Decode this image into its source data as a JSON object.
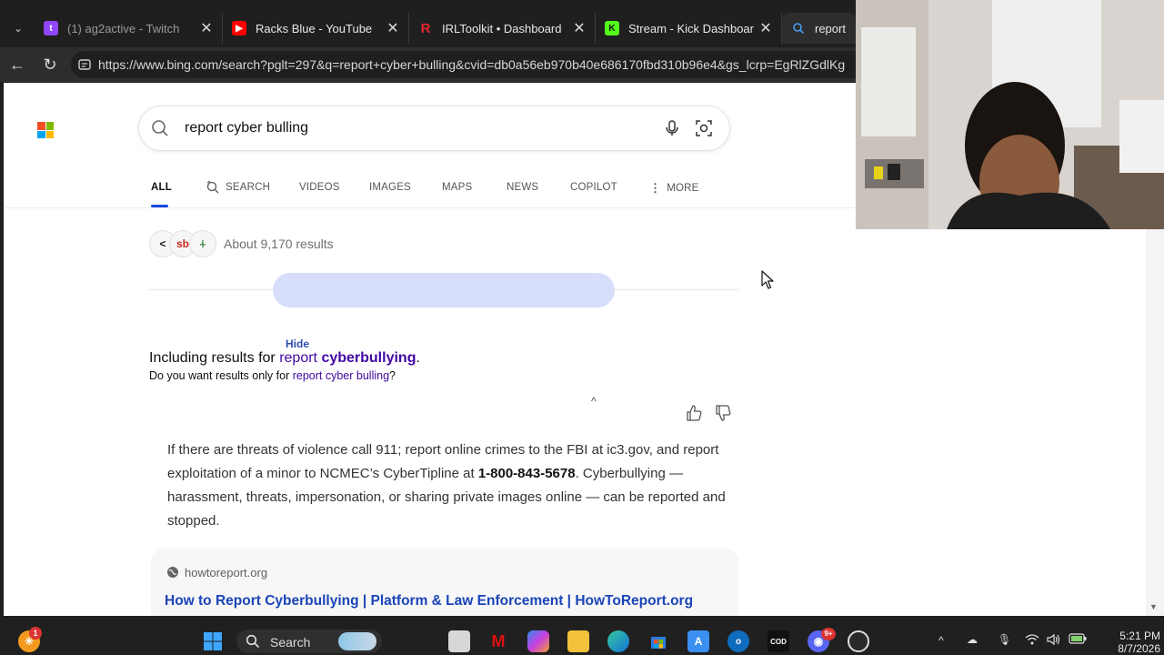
{
  "browser": {
    "tabs": [
      {
        "title": "(1) ag2active - Twitch",
        "icon": "twitch-icon",
        "color": "#9146ff"
      },
      {
        "title": "Racks Blue - YouTube",
        "icon": "youtube-icon",
        "color": "#ff0000"
      },
      {
        "title": "IRLToolkit • Dashboard",
        "icon": "irltoolkit-icon",
        "color": "#e3262f"
      },
      {
        "title": "Stream - Kick Dashboard",
        "icon": "kick-icon",
        "color": "#53fc18"
      },
      {
        "title": "report cybe",
        "icon": "search-icon",
        "color": "#4a9cf0"
      }
    ],
    "close_glyph": "✕",
    "url": "https://www.bing.com/search?pglt=297&q=report+cyber+bulling&cvid=db0a56eb970b40e686170fbd310b96e4&gs_lcrp=EgRlZGdlKg"
  },
  "bing": {
    "query": "report cyber bulling",
    "scopes": [
      {
        "label": "ALL",
        "active": true
      },
      {
        "label": "SEARCH",
        "icon": "copilot-search-icon"
      },
      {
        "label": "VIDEOS"
      },
      {
        "label": "IMAGES"
      },
      {
        "label": "MAPS"
      },
      {
        "label": "NEWS"
      },
      {
        "label": "COPILOT"
      },
      {
        "label": "MORE",
        "icon": "more-dots-icon"
      }
    ],
    "source_icons": [
      "<",
      "sb",
      "⍭"
    ],
    "results_count": "About 9,170 results",
    "hide_label": "Hide",
    "including_prefix": "Including results for ",
    "including_link_plain": "report ",
    "including_link_bold": "cyberbullying",
    "including_suffix": ".",
    "only_prefix": "Do you want results only for ",
    "only_link": "report cyber bulling",
    "only_suffix": "?",
    "answer": {
      "part1": "If there are threats of violence call 911; report online crimes to the FBI at ic3.gov, and report exploitation of a minor to NCMEC’s CyberTipline at ",
      "phone": "1-800-843-5678",
      "part2": ". Cyberbullying — harassment, threats, impersonation, or sharing private images online — can be reported and stopped."
    },
    "card": {
      "site": "howtoreport.org",
      "title": "How to Report Cyberbullying | Platform & Law Enforcement | HowToReport.org"
    }
  },
  "taskbar": {
    "search_label": "Search",
    "notification_badge": "1",
    "discord_badge": "9+",
    "clock_time": "5:21 PM",
    "clock_date": "8/7/2026"
  },
  "colors": {
    "accent": "#174ae4",
    "link": "#4007a2",
    "title_link": "#1a44b8",
    "loading": "#d6defa"
  }
}
